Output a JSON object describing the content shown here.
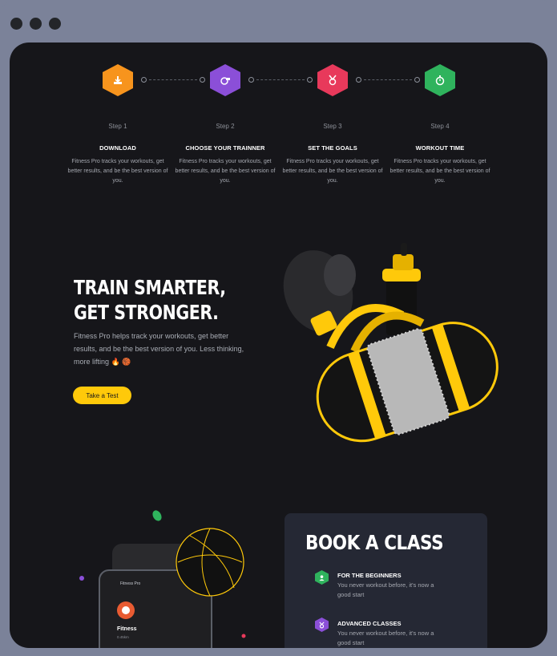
{
  "steps": [
    {
      "number": "Step 1",
      "title": "DOWNLOAD",
      "description": "Fitness Pro tracks your workouts, get better results, and be the best version of you.",
      "icon": "download-icon",
      "color": "#f7941d"
    },
    {
      "number": "Step 2",
      "title": "CHOOSE YOUR TRAINNER",
      "description": "Fitness Pro tracks your workouts, get better results, and be the best version of you.",
      "icon": "whistle-icon",
      "color": "#8b4fd8"
    },
    {
      "number": "Step 3",
      "title": "SET THE GOALS",
      "description": "Fitness Pro tracks your workouts, get better results, and be the best version of you.",
      "icon": "medal-icon",
      "color": "#e8395b"
    },
    {
      "number": "Step 4",
      "title": "WORKOUT TIME",
      "description": "Fitness Pro tracks your workouts, get better results, and be the best version of you.",
      "icon": "stopwatch-icon",
      "color": "#2fb35d"
    }
  ],
  "hero": {
    "title_line1": "TRAIN SMARTER,",
    "title_line2": "GET STRONGER.",
    "description": "Fitness Pro helps track your workouts, get better results, and be the best version of you. Less thinking, more lifting 🔥 🏀",
    "cta_label": "Take a Test"
  },
  "phone": {
    "app_name": "Fitness Pro",
    "card_title": "Fitness",
    "card_sub": "0.45km"
  },
  "book_class": {
    "title": "BOOK A CLASS",
    "classes": [
      {
        "title": "FOR THE BEGINNERS",
        "description": "You never workout before, it's now a good start",
        "icon": "user-icon",
        "color": "#2fb35d"
      },
      {
        "title": "ADVANCED CLASSES",
        "description": "You never workout before, it's now a good start",
        "icon": "medal-icon",
        "color": "#8b4fd8"
      }
    ]
  },
  "colors": {
    "accent": "#ffc90a",
    "background": "#16161a",
    "card": "#252834"
  }
}
